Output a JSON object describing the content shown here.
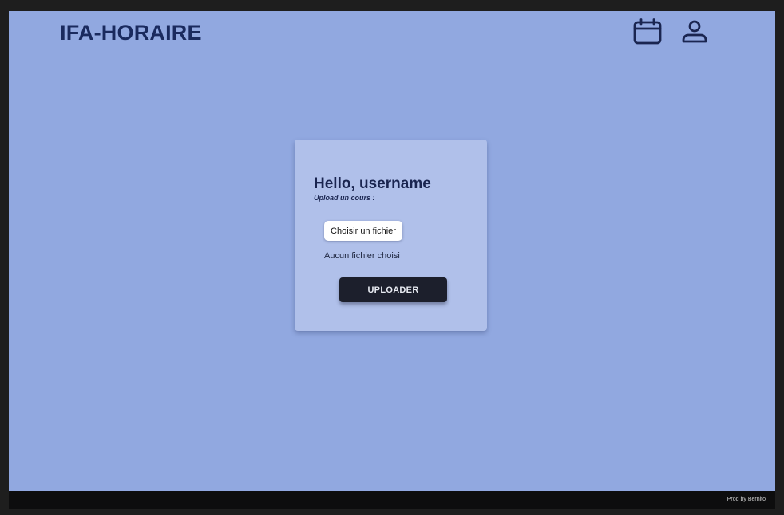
{
  "header": {
    "title": "IFA-HORAIRE",
    "icons": {
      "calendar": "calendar-icon",
      "profile": "user-icon"
    }
  },
  "upload_card": {
    "greeting": "Hello, username",
    "subtitle": "Upload un cours :",
    "file_button_label": "Choisir un fichier",
    "file_status": "Aucun fichier choisi",
    "submit_label": "UPLOADER"
  },
  "footer": {
    "credit": "Prod by Bernito"
  },
  "colors": {
    "background": "#91a8e0",
    "card": "#b0c0ea",
    "title": "#1a2a5e",
    "button_dark": "#1c1f2c",
    "footer": "#0d0d0e",
    "outer_frame": "#1e1e1e"
  }
}
